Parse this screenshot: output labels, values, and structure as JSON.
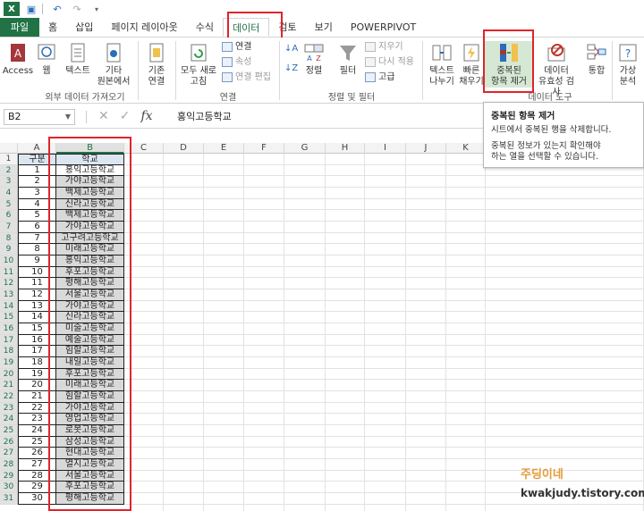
{
  "tabs": [
    {
      "label": "파일",
      "name": "tab-file"
    },
    {
      "label": "홈",
      "name": "tab-home"
    },
    {
      "label": "삽입",
      "name": "tab-insert"
    },
    {
      "label": "페이지 레이아웃",
      "name": "tab-page-layout"
    },
    {
      "label": "수식",
      "name": "tab-formulas"
    },
    {
      "label": "데이터",
      "name": "tab-data"
    },
    {
      "label": "검토",
      "name": "tab-review"
    },
    {
      "label": "보기",
      "name": "tab-view"
    },
    {
      "label": "POWERPIVOT",
      "name": "tab-powerpivot"
    }
  ],
  "ribbon": {
    "access": "Access",
    "web": "웹",
    "text": "텍스트",
    "other_sources": "기타\n원본에서",
    "existing_conn": "기존\n연결",
    "refresh_all": "모두 새로\n고침",
    "connections": "연결",
    "properties": "속성",
    "edit_links": "연결 편집",
    "sort": "정렬",
    "filter": "필터",
    "clear": "지우기",
    "reapply": "다시 적용",
    "advanced": "고급",
    "text_to_columns": "텍스트\n나누기",
    "flash_fill": "빠른\n채우기",
    "remove_duplicates": "중복된\n항목 제거",
    "data_validation": "데이터\n유효성 검사",
    "consolidate": "통합",
    "what_if": "가상\n분석",
    "group_external": "외부 데이터 가져오기",
    "group_connections": "연결",
    "group_sort_filter": "정렬 및 필터",
    "group_data_tools": "데이터 도구"
  },
  "formula_bar": {
    "name_box": "B2",
    "value": "홍익고등학교"
  },
  "tooltip": {
    "title": "중복된 항목 제거",
    "line1": "시트에서 중복된 행을 삭제합니다.",
    "line2": "중복된 정보가 있는지 확인해야",
    "line3": "하는 열을 선택할 수 있습니다."
  },
  "columns": [
    "A",
    "B",
    "C",
    "D",
    "E",
    "F",
    "G",
    "H",
    "I",
    "J",
    "K"
  ],
  "table": {
    "header_a": "구분",
    "header_b": "학교",
    "rows": [
      [
        "1",
        "홍익고등학교"
      ],
      [
        "2",
        "가야고등학교"
      ],
      [
        "3",
        "백제고등학교"
      ],
      [
        "4",
        "신라고등학교"
      ],
      [
        "5",
        "백제고등학교"
      ],
      [
        "6",
        "가야고등학교"
      ],
      [
        "7",
        "고구려고등학교"
      ],
      [
        "8",
        "미래고등학교"
      ],
      [
        "9",
        "홍익고등학교"
      ],
      [
        "10",
        "후포고등학교"
      ],
      [
        "11",
        "평해고등학교"
      ],
      [
        "12",
        "서울고등학교"
      ],
      [
        "13",
        "가야고등학교"
      ],
      [
        "14",
        "신라고등학교"
      ],
      [
        "15",
        "미술고등학교"
      ],
      [
        "16",
        "예술고등학교"
      ],
      [
        "17",
        "힘할고등학교"
      ],
      [
        "18",
        "내일고등학교"
      ],
      [
        "19",
        "후포고등학교"
      ],
      [
        "20",
        "미래고등학교"
      ],
      [
        "21",
        "힘할고등학교"
      ],
      [
        "22",
        "가야고등학교"
      ],
      [
        "23",
        "영업고등학교"
      ],
      [
        "24",
        "로봇고등학교"
      ],
      [
        "25",
        "삼성고등학교"
      ],
      [
        "26",
        "현대고등학교"
      ],
      [
        "27",
        "열지고등학교"
      ],
      [
        "28",
        "서울고등학교"
      ],
      [
        "29",
        "후포고등학교"
      ],
      [
        "30",
        "평해고등학교"
      ]
    ]
  },
  "watermark": {
    "line1": "주딩이네",
    "line2": "kwakjudy.tistory.com"
  },
  "colors": {
    "accent": "#217346",
    "highlight": "#e0242b"
  }
}
